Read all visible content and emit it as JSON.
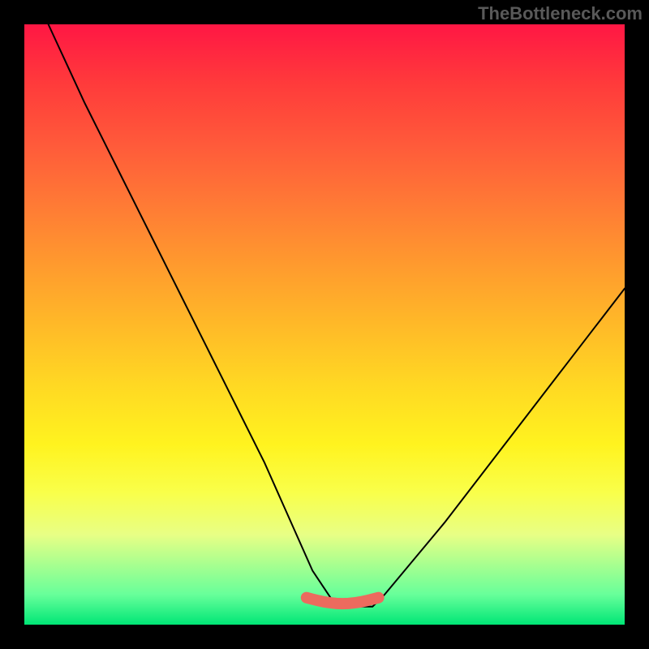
{
  "watermark": "TheBottleneck.com",
  "chart_data": {
    "type": "line",
    "title": "",
    "xlabel": "",
    "ylabel": "",
    "xlim": [
      0,
      100
    ],
    "ylim": [
      0,
      100
    ],
    "grid": false,
    "legend": false,
    "background": "rainbow-gradient",
    "description": "Bottleneck curve plot showing a V-shaped black line over a vertical rainbow gradient (red at top through orange/yellow to green at bottom). Minimum region highlighted in coral/salmon near the bottom center.",
    "series": [
      {
        "name": "bottleneck-curve",
        "color": "#000000",
        "x": [
          4,
          10,
          20,
          30,
          40,
          48,
          52,
          58,
          60,
          70,
          80,
          90,
          100
        ],
        "y": [
          100,
          87,
          67,
          47,
          27,
          9,
          3,
          3,
          5,
          17,
          30,
          43,
          56
        ]
      },
      {
        "name": "optimum-highlight",
        "color": "#ec6b5e",
        "x": [
          47,
          59
        ],
        "y": [
          3,
          3
        ]
      }
    ]
  }
}
